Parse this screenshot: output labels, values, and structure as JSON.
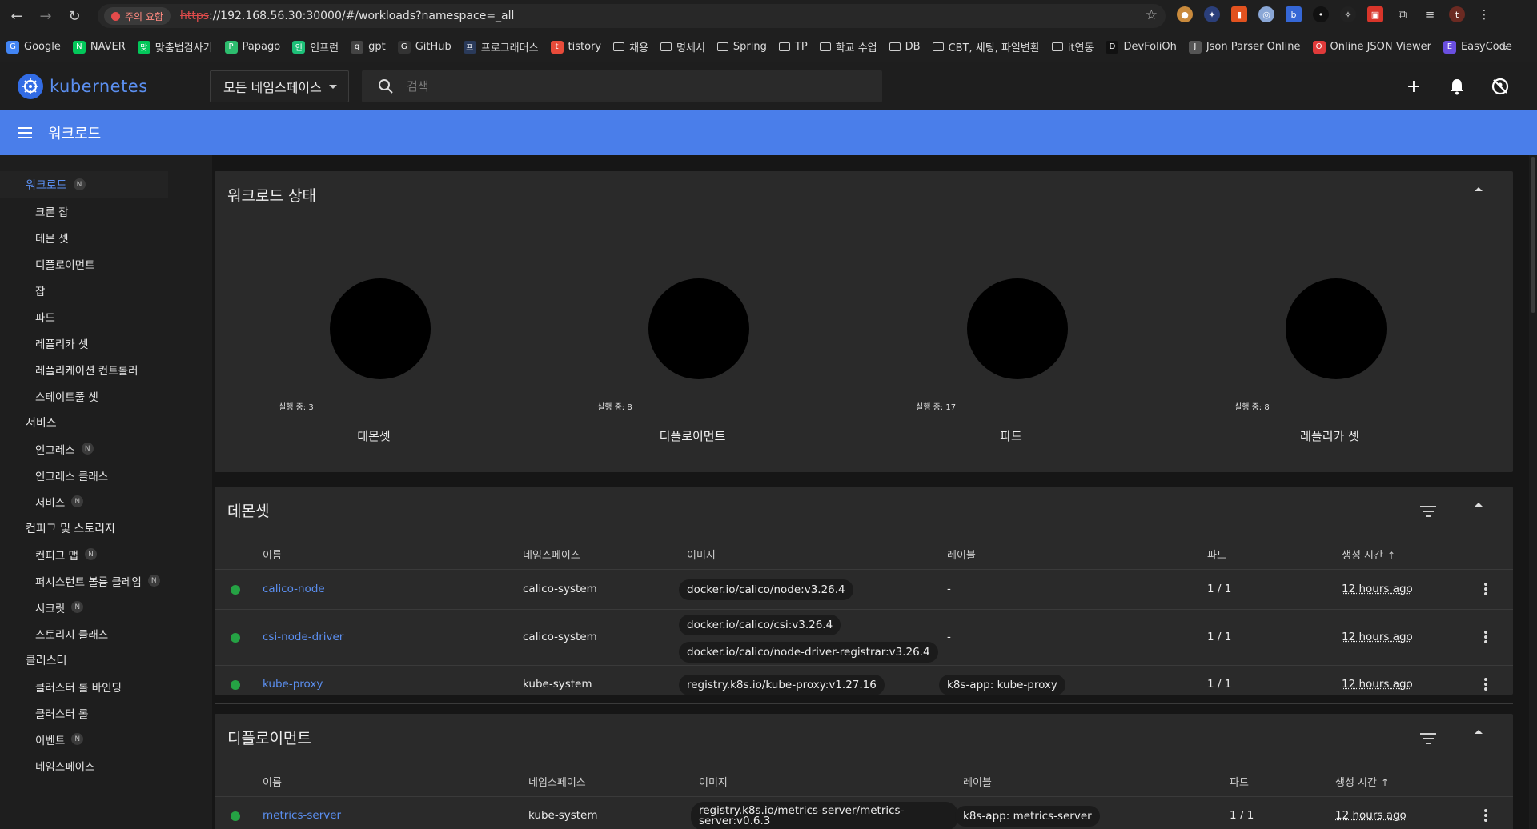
{
  "browser": {
    "security_chip": "주의 요함",
    "url_scheme": "https",
    "url_rest": "://192.168.56.30:30000/#/workloads?namespace=_all",
    "bookmarks": [
      {
        "label": "Google",
        "icon": "google-icon",
        "color": "#4285f4"
      },
      {
        "label": "NAVER",
        "icon": "naver-icon",
        "color": "#03c75a"
      },
      {
        "label": "맞춤법검사기",
        "icon": "naver-icon",
        "color": "#03c75a"
      },
      {
        "label": "Papago",
        "icon": "papago-icon",
        "color": "#2dbd6e"
      },
      {
        "label": "인프런",
        "icon": "inflearn-icon",
        "color": "#1dc078"
      },
      {
        "label": "gpt",
        "icon": "openai-icon",
        "color": "#444444"
      },
      {
        "label": "GitHub",
        "icon": "github-icon",
        "color": "#333333"
      },
      {
        "label": "프로그래머스",
        "icon": "programmers-icon",
        "color": "#2a3a5a"
      },
      {
        "label": "tistory",
        "icon": "tistory-icon",
        "color": "#e84b3a"
      },
      {
        "label": "채용",
        "icon": "folder-icon"
      },
      {
        "label": "명세서",
        "icon": "folder-icon"
      },
      {
        "label": "Spring",
        "icon": "folder-icon"
      },
      {
        "label": "TP",
        "icon": "folder-icon"
      },
      {
        "label": "학교 수업",
        "icon": "folder-icon"
      },
      {
        "label": "DB",
        "icon": "folder-icon"
      },
      {
        "label": "CBT, 세팅, 파일변환",
        "icon": "folder-icon"
      },
      {
        "label": "it연동",
        "icon": "folder-icon"
      },
      {
        "label": "DevFoliOh",
        "icon": "devfolioh-icon",
        "color": "#111111"
      },
      {
        "label": "Json Parser Online",
        "icon": "json-parser-icon",
        "color": "#555555"
      },
      {
        "label": "Online JSON Viewer",
        "icon": "opera-icon",
        "color": "#e03a3a"
      },
      {
        "label": "EasyCode",
        "icon": "easycode-icon",
        "color": "#6a4fe0"
      }
    ]
  },
  "header": {
    "brand": "kubernetes",
    "namespace_select": "모든 네임스페이스",
    "search_placeholder": "검색"
  },
  "title_bar": {
    "title": "워크로드"
  },
  "sidebar": {
    "items": [
      {
        "label": "워크로드",
        "level": "group",
        "badge": "N",
        "active": true
      },
      {
        "label": "크론 잡",
        "level": "sub"
      },
      {
        "label": "데몬 셋",
        "level": "sub"
      },
      {
        "label": "디플로이먼트",
        "level": "sub"
      },
      {
        "label": "잡",
        "level": "sub"
      },
      {
        "label": "파드",
        "level": "sub"
      },
      {
        "label": "레플리카 셋",
        "level": "sub"
      },
      {
        "label": "레플리케이션 컨트롤러",
        "level": "sub"
      },
      {
        "label": "스테이트풀 셋",
        "level": "sub"
      },
      {
        "label": "서비스",
        "level": "group"
      },
      {
        "label": "인그레스",
        "level": "sub",
        "badge": "N"
      },
      {
        "label": "인그레스 클래스",
        "level": "sub"
      },
      {
        "label": "서비스",
        "level": "sub",
        "badge": "N"
      },
      {
        "label": "컨피그 및 스토리지",
        "level": "group"
      },
      {
        "label": "컨피그 맵",
        "level": "sub",
        "badge": "N"
      },
      {
        "label": "퍼시스턴트 볼륨 클레임",
        "level": "sub",
        "badge": "N"
      },
      {
        "label": "시크릿",
        "level": "sub",
        "badge": "N"
      },
      {
        "label": "스토리지 클래스",
        "level": "sub"
      },
      {
        "label": "클러스터",
        "level": "group"
      },
      {
        "label": "클러스터 롤 바인딩",
        "level": "sub"
      },
      {
        "label": "클러스터 롤",
        "level": "sub"
      },
      {
        "label": "이벤트",
        "level": "sub",
        "badge": "N"
      },
      {
        "label": "네임스페이스",
        "level": "sub"
      }
    ]
  },
  "workload_status": {
    "title": "워크로드 상태",
    "charts": [
      {
        "label": "데몬셋",
        "legend": "실행 중: 3",
        "running": 3
      },
      {
        "label": "디플로이먼트",
        "legend": "실행 중: 8",
        "running": 8
      },
      {
        "label": "파드",
        "legend": "실행 중: 17",
        "running": 17
      },
      {
        "label": "레플리카 셋",
        "legend": "실행 중: 8",
        "running": 8
      }
    ]
  },
  "table_headers": {
    "name": "이름",
    "namespace": "네임스페이스",
    "images": "이미지",
    "labels": "레이블",
    "pods": "파드",
    "created": "생성 시간",
    "sort_arrow": "↑"
  },
  "daemonsets": {
    "title": "데몬셋",
    "rows": [
      {
        "name": "calico-node",
        "namespace": "calico-system",
        "images": [
          "docker.io/calico/node:v3.26.4"
        ],
        "labels": "-",
        "pods": "1 / 1",
        "created": "12 hours ago",
        "status_color": "#25a244"
      },
      {
        "name": "csi-node-driver",
        "namespace": "calico-system",
        "images": [
          "docker.io/calico/csi:v3.26.4",
          "docker.io/calico/node-driver-registrar:v3.26.4"
        ],
        "labels": "-",
        "pods": "1 / 1",
        "created": "12 hours ago",
        "status_color": "#25a244"
      },
      {
        "name": "kube-proxy",
        "namespace": "kube-system",
        "images": [
          "registry.k8s.io/kube-proxy:v1.27.16"
        ],
        "labels": "k8s-app: kube-proxy",
        "pods": "1 / 1",
        "created": "12 hours ago",
        "status_color": "#25a244"
      }
    ]
  },
  "deployments": {
    "title": "디플로이먼트",
    "rows": [
      {
        "name": "metrics-server",
        "namespace": "kube-system",
        "images": [
          "registry.k8s.io/metrics-server/metrics-server:v0.6.3"
        ],
        "labels": "k8s-app: metrics-server",
        "pods": "1 / 1",
        "created": "12 hours ago",
        "status_color": "#25a244"
      }
    ]
  },
  "colors": {
    "accent": "#4a7eea",
    "link": "#5b8ff0",
    "running": "#25a244"
  }
}
